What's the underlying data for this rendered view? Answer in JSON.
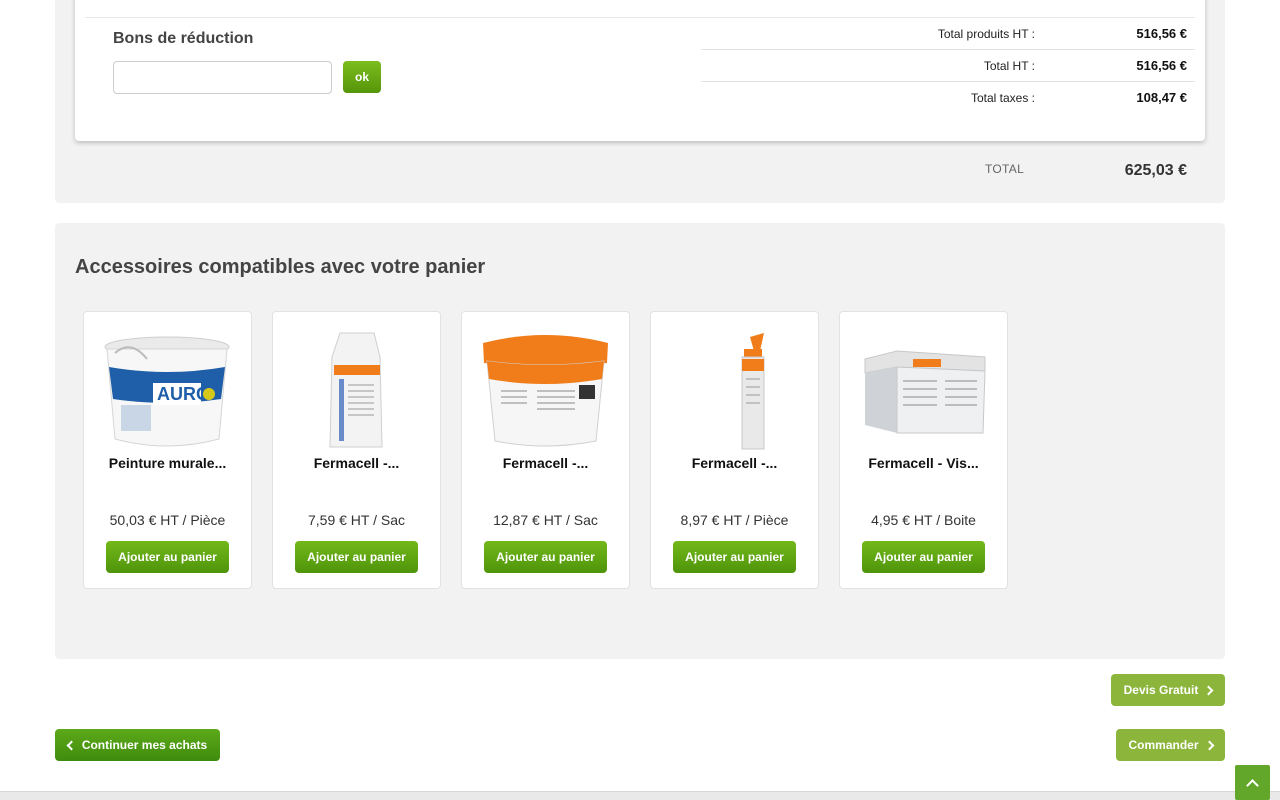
{
  "cart_summary": {
    "coupon": {
      "title": "Bons de réduction",
      "input_value": "",
      "input_placeholder": "",
      "submit_label": "ok"
    },
    "totals": [
      {
        "label": "Total produits HT :",
        "value": "516,56 €"
      },
      {
        "label": "Total HT :",
        "value": "516,56 €"
      },
      {
        "label": "Total taxes :",
        "value": "108,47 €"
      }
    ],
    "grand_total": {
      "label": "TOTAL",
      "value": "625,03 €"
    }
  },
  "accessories": {
    "title": "Accessoires compatibles avec votre panier",
    "products": [
      {
        "name": "Peinture murale...",
        "price": "50,03 € HT / Pièce",
        "button": "Ajouter au panier",
        "image_icon": "paint-bucket-auro-icon"
      },
      {
        "name": "Fermacell -...",
        "price": "7,59 € HT / Sac",
        "button": "Ajouter au panier",
        "image_icon": "filler-bag-icon"
      },
      {
        "name": "Fermacell -...",
        "price": "12,87 € HT / Sac",
        "button": "Ajouter au panier",
        "image_icon": "paint-bucket-fermacell-icon"
      },
      {
        "name": "Fermacell -...",
        "price": "8,97 € HT / Pièce",
        "button": "Ajouter au panier",
        "image_icon": "sealant-cartridge-icon"
      },
      {
        "name": "Fermacell - Vis...",
        "price": "4,95 € HT / Boite",
        "button": "Ajouter au panier",
        "image_icon": "screw-box-icon"
      }
    ]
  },
  "actions": {
    "quote_label": "Devis Gratuit",
    "continue_label": "Continuer mes achats",
    "order_label": "Commander"
  },
  "colors": {
    "primary_green": "#5da919",
    "light_green": "#8cb53c",
    "fermacell_orange": "#f07d1a"
  }
}
